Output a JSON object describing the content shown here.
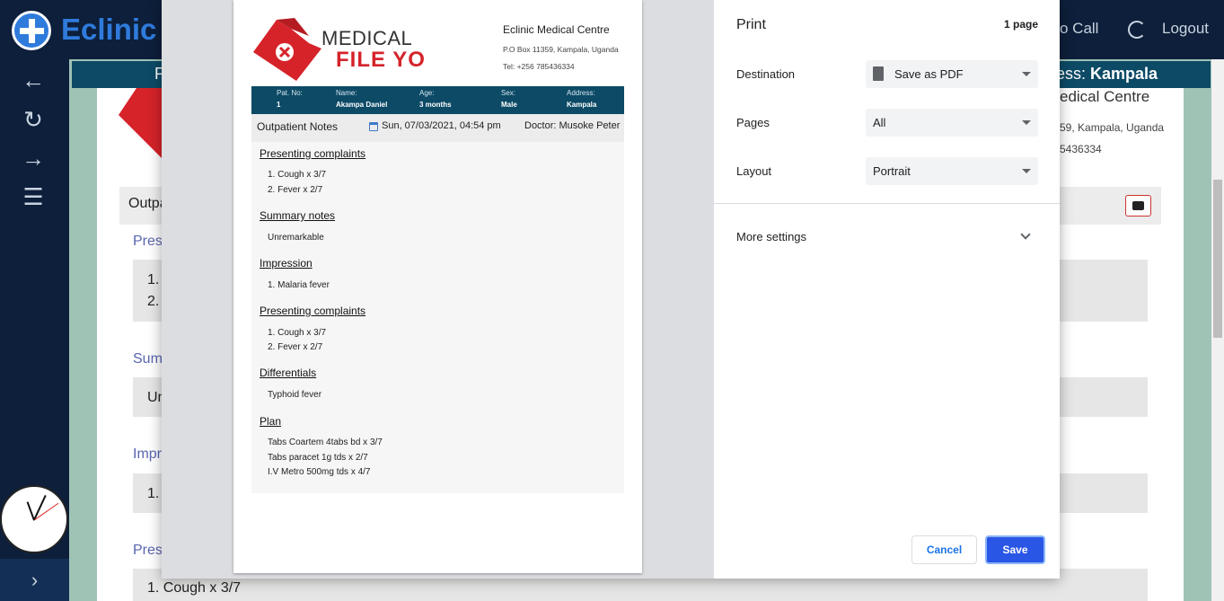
{
  "app": {
    "brand": "Eclinic",
    "nav_call": "o Call",
    "nav_logout": "Logout",
    "patient_band_prefix": "P",
    "address_right_prefix": "ress: ",
    "address_right_value": "Kampala",
    "centre_right": "edical Centre",
    "box_right_1": "59, Kampala, Uganda",
    "box_right_2": "5436334",
    "bg_notes_prefix": "Outpa",
    "bg_sec_presenting": "Pres",
    "bg_item_1": "1.",
    "bg_item_2": "2.",
    "bg_sec_summary": "Sum",
    "bg_summary_value": "Un",
    "bg_sec_impression": "Impr",
    "bg_impression_item": "1.",
    "bg_sec_presenting2": "Pres",
    "bg_bottom_line": "1. Cough x 3/7"
  },
  "sidebar": {
    "icons": [
      "arrow-left-icon",
      "refresh-icon",
      "arrow-right-icon",
      "menu-icon"
    ],
    "bottom": "›"
  },
  "preview": {
    "logo_text_1": "MEDICAL",
    "logo_text_2": "FILE YO",
    "clinic_name": "Eclinic Medical Centre",
    "clinic_box": "P.O Box 11359, Kampala, Uganda",
    "clinic_tel": "Tel: +256 785436334",
    "patient": {
      "no_label": "Pat. No:",
      "no_value": "1",
      "name_label": "Name:",
      "name_value": "Akampa Daniel",
      "age_label": "Age:",
      "age_value": "3 months",
      "sex_label": "Sex:",
      "sex_value": "Male",
      "address_label": "Address:",
      "address_value": "Kampala"
    },
    "notes_title": "Outpatient Notes",
    "notes_date": "Sun, 07/03/2021, 04:54 pm",
    "notes_doctor": "Doctor: Musoke Peter",
    "sections": {
      "s1_title": "Presenting complaints",
      "s1_l1": "1. Cough x 3/7",
      "s1_l2": "2. Fever x 2/7",
      "s2_title": "Summary notes",
      "s2_l1": "Unremarkable",
      "s3_title": "Impression",
      "s3_l1": "1. Malaria fever",
      "s4_title": "Presenting complaints",
      "s4_l1": "1. Cough x 3/7",
      "s4_l2": "2. Fever x 2/7",
      "s5_title": "Differentials",
      "s5_l1": "Typhoid fever",
      "s6_title": "Plan",
      "s6_l1": "Tabs Coartem 4tabs bd x 3/7",
      "s6_l2": "Tabs paracet 1g tds x 2/7",
      "s6_l3": "I.V Metro 500mg tds x 4/7"
    }
  },
  "print": {
    "title": "Print",
    "page_count": "1 page",
    "destination_label": "Destination",
    "destination_value": "Save as PDF",
    "pages_label": "Pages",
    "pages_value": "All",
    "layout_label": "Layout",
    "layout_value": "Portrait",
    "more_settings": "More settings",
    "cancel": "Cancel",
    "save": "Save"
  },
  "colors": {
    "navy": "#0d1f3a",
    "band_teal": "#0c4a66",
    "brand_blue": "#2f7bdc",
    "logo_red": "#d6232a",
    "save_blue": "#2a56e6"
  }
}
